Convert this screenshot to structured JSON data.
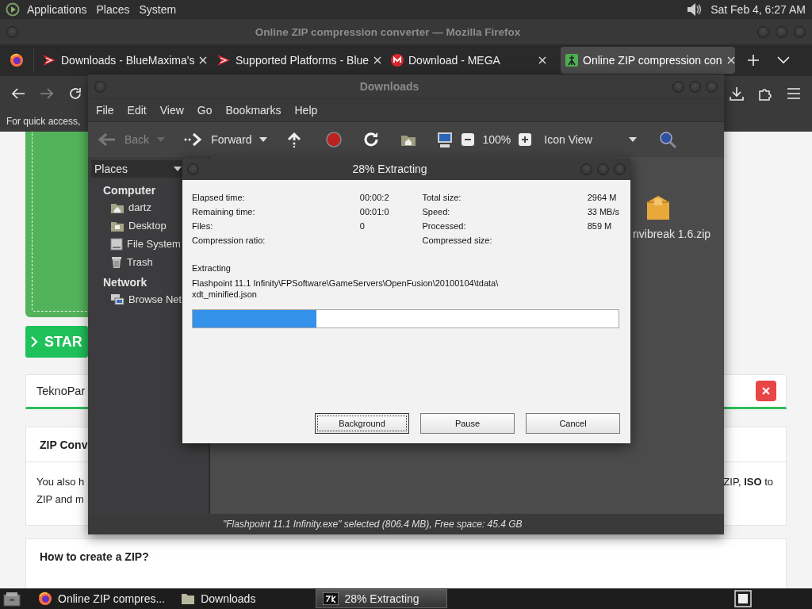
{
  "top_panel": {
    "menus": [
      "Applications",
      "Places",
      "System"
    ],
    "clock": "Sat Feb 4, 6:27 AM"
  },
  "browser": {
    "title": "Online ZIP compression converter — Mozilla Firefox",
    "tabs": [
      {
        "label": "Downloads - BlueMaxima's",
        "kind": "flashpoint",
        "selected": false
      },
      {
        "label": "Supported Platforms - Blue",
        "kind": "flashpoint",
        "selected": false
      },
      {
        "label": "Download - MEGA",
        "kind": "mega",
        "selected": false
      },
      {
        "label": "Online ZIP compression con",
        "kind": "site",
        "selected": true
      }
    ],
    "forward_disabled": true,
    "bookmarks_hint": "For quick access,",
    "page": {
      "start_button": "STAR",
      "notice": "TeknoPar",
      "card_title": "ZIP Conv",
      "card_lines": [
        "You also h",
        "ZIP and m"
      ],
      "card_right": "ZIP, **ISO** to",
      "how_to_title": "How to create a ZIP?"
    }
  },
  "file_manager": {
    "title": "Downloads",
    "menus": [
      "File",
      "Edit",
      "View",
      "Go",
      "Bookmarks",
      "Help"
    ],
    "toolbar": {
      "back": {
        "label": "Back",
        "disabled": true
      },
      "forward": {
        "label": "Forward",
        "disabled": false
      },
      "zoom": "100%",
      "view": "Icon View"
    },
    "places_label": "Places",
    "sidebar": [
      {
        "heading": "Computer",
        "items": [
          {
            "label": "dartz",
            "kind": "home"
          },
          {
            "label": "Desktop",
            "kind": "desktop"
          },
          {
            "label": "File System",
            "kind": "drive"
          },
          {
            "label": "Trash",
            "kind": "trash"
          }
        ]
      },
      {
        "heading": "Network",
        "items": [
          {
            "label": "Browse Net",
            "kind": "network"
          }
        ]
      }
    ],
    "files": [
      {
        "name": "nvibreak 1.6.zip"
      }
    ],
    "status": "\"Flashpoint 11.1 Infinity.exe\" selected (806.4 MB), Free space: 45.4 GB"
  },
  "dialog": {
    "title": "28% Extracting",
    "stats_left": [
      {
        "label": "Elapsed time:",
        "value": "00:00:2"
      },
      {
        "label": "Remaining time:",
        "value": "00:01:0"
      },
      {
        "label": "Files:",
        "value": "0"
      },
      {
        "label": "Compression ratio:"
      }
    ],
    "stats_right": [
      {
        "label": "Total size:",
        "value": "2964 M"
      },
      {
        "label": "Speed:",
        "value": "33 MB/s"
      },
      {
        "label": "Processed:",
        "value": "859 M"
      },
      {
        "label": "Compressed size:"
      }
    ],
    "operation": "Extracting",
    "path_lines": [
      "Flashpoint 11.1 Infinity\\FPSoftware\\GameServers\\OpenFusion\\20100104\\tdata\\",
      "xdt_minified.json"
    ],
    "progress": {
      "level": 0.29
    },
    "buttons": [
      {
        "label": "Background",
        "focused": true
      },
      {
        "label": "Pause",
        "focused": false
      },
      {
        "label": "Cancel",
        "focused": false
      }
    ]
  },
  "taskbar": [
    {
      "label": "Online ZIP compres...",
      "kind": "firefox",
      "selected": false
    },
    {
      "label": "Downloads",
      "kind": "folder",
      "selected": false
    },
    {
      "label": "28% Extracting",
      "kind": "archiver",
      "selected": true
    }
  ]
}
